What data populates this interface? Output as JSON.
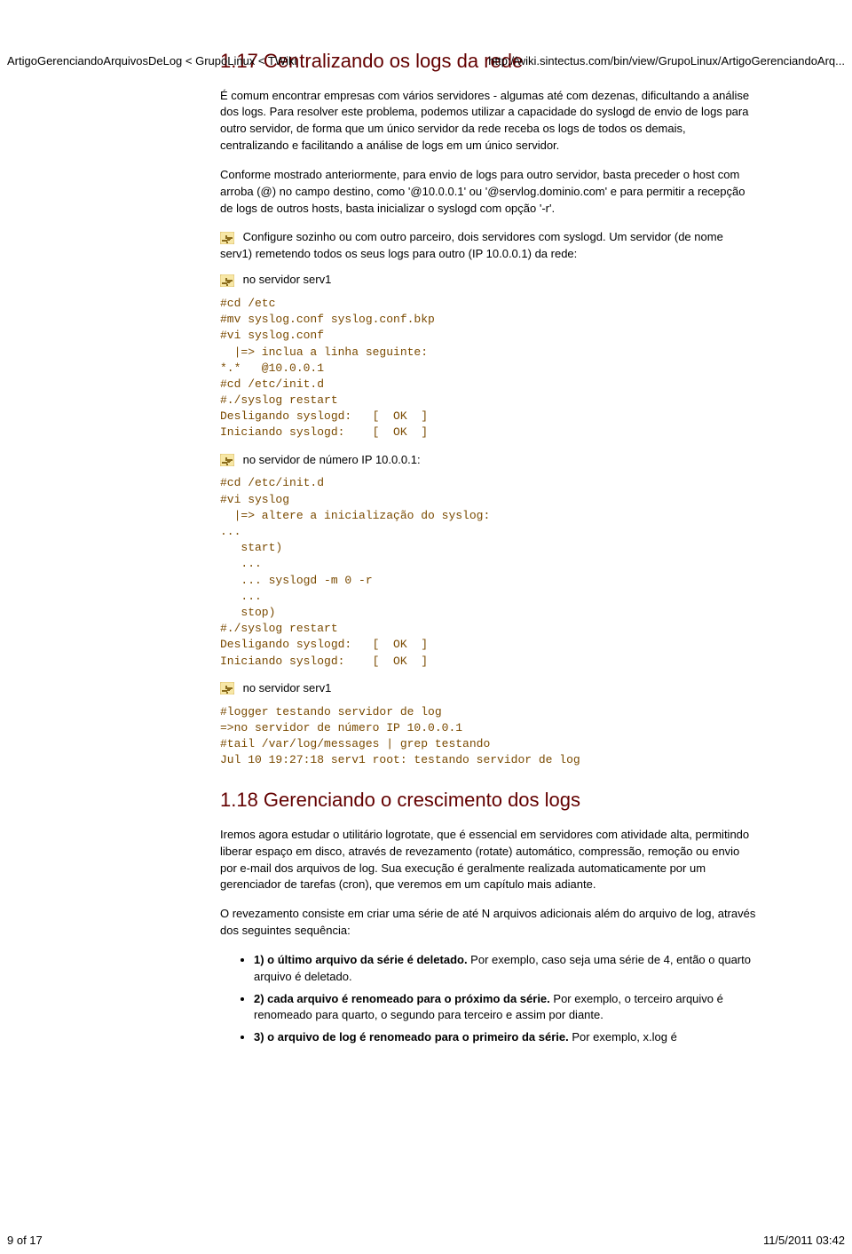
{
  "header": {
    "left": "ArtigoGerenciandoArquivosDeLog < GrupoLinux < TWiki",
    "right": "http://wiki.sintectus.com/bin/view/GrupoLinux/ArtigoGerenciandoArq..."
  },
  "footer": {
    "left": "9 of 17",
    "right": "11/5/2011 03:42"
  },
  "section117": {
    "heading": "1.17 Centralizando os logs da rede",
    "p1": "É comum encontrar empresas com vários servidores - algumas até com dezenas, dificultando a análise dos logs. Para resolver este problema, podemos utilizar a capacidade do syslogd de envio de logs para outro servidor, de forma que um único servidor da rede receba os logs de todos os demais, centralizando e facilitando a análise de logs em um único servidor.",
    "p2": "Conforme mostrado anteriormente, para envio de logs para outro servidor, basta preceder o host com arroba (@) no campo destino, como '@10.0.0.1' ou '@servlog.dominio.com' e para permitir a recepção de logs de outros hosts, basta inicializar o syslogd com opção '-r'.",
    "tip1": " Configure sozinho ou com outro parceiro, dois servidores com syslogd. Um servidor (de nome serv1) remetendo todos os seus logs para outro (IP 10.0.0.1) da rede:",
    "tip2": " no servidor serv1",
    "code1": "#cd /etc\n#mv syslog.conf syslog.conf.bkp\n#vi syslog.conf\n  |=> inclua a linha seguinte:\n*.*   @10.0.0.1\n#cd /etc/init.d\n#./syslog restart\nDesligando syslogd:   [  OK  ]\nIniciando syslogd:    [  OK  ]",
    "tip3": " no servidor de número IP 10.0.0.1:",
    "code2": "#cd /etc/init.d\n#vi syslog\n  |=> altere a inicialização do syslog:\n...\n   start)\n   ...\n   ... syslogd -m 0 -r\n   ...\n   stop)\n#./syslog restart\nDesligando syslogd:   [  OK  ]\nIniciando syslogd:    [  OK  ]",
    "tip4": " no servidor serv1",
    "code3": "#logger testando servidor de log\n=>no servidor de número IP 10.0.0.1\n#tail /var/log/messages | grep testando\nJul 10 19:27:18 serv1 root: testando servidor de log"
  },
  "section118": {
    "heading": "1.18 Gerenciando o crescimento dos logs",
    "p1": "Iremos agora estudar o utilitário logrotate, que é essencial em servidores com atividade alta, permitindo liberar espaço em disco, através de revezamento (rotate) automático, compressão, remoção ou envio por e-mail dos arquivos de log. Sua execução é geralmente realizada automaticamente por um gerenciador de tarefas (cron), que veremos em um capítulo mais adiante.",
    "p2": "O revezamento consiste em criar uma série de até N arquivos adicionais além do arquivo de log, através dos seguintes sequência:",
    "bullets": [
      {
        "bold": "1) o último arquivo da série é deletado.",
        "rest": " Por exemplo, caso seja uma série de 4, então o quarto arquivo é deletado."
      },
      {
        "bold": "2) cada arquivo é renomeado para o próximo da série.",
        "rest": " Por exemplo, o terceiro arquivo é renomeado para quarto, o segundo para terceiro e assim por diante."
      },
      {
        "bold": "3) o arquivo de log é renomeado para o primeiro da série.",
        "rest": " Por exemplo, x.log é"
      }
    ]
  }
}
